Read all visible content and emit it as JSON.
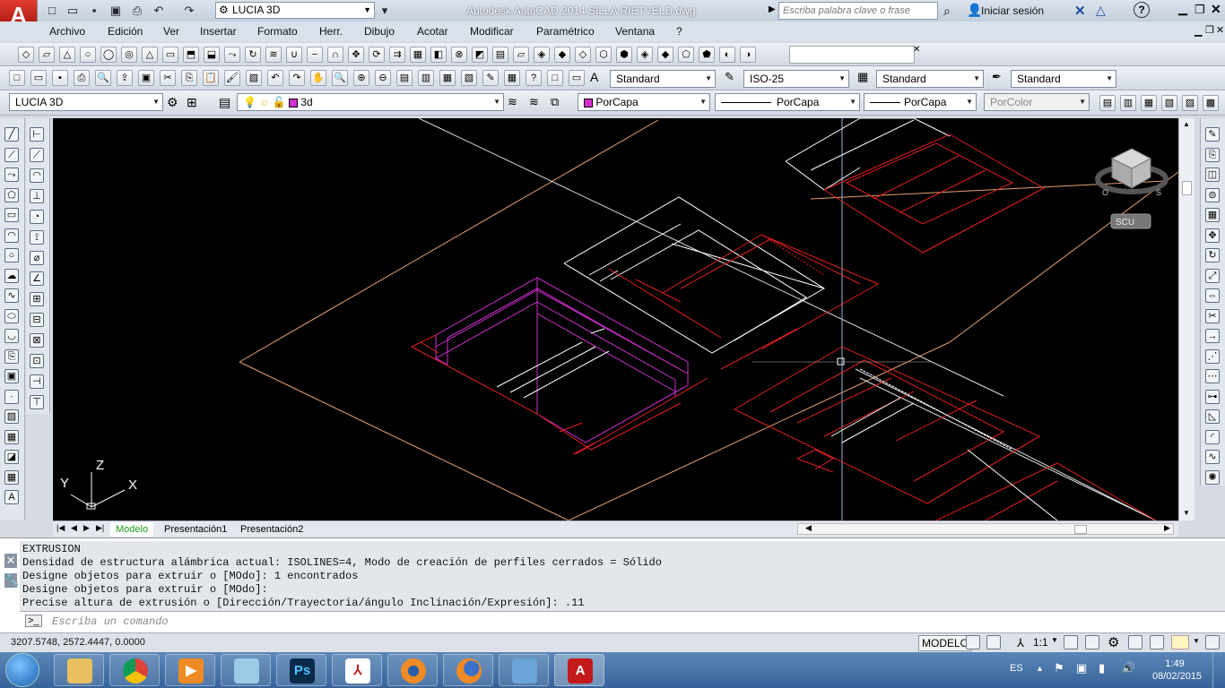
{
  "titlebar": {
    "app_letter": "A",
    "workspace": "LUCIA 3D",
    "title": "Autodesk AutoCAD 2014    SILLA RIETVELD.dwg",
    "search_placeholder": "Escriba palabra clave o frase",
    "signin": "Iniciar sesión",
    "help": "?"
  },
  "menu": [
    "Archivo",
    "Edición",
    "Ver",
    "Insertar",
    "Formato",
    "Herr.",
    "Dibujo",
    "Acotar",
    "Modificar",
    "Paramétrico",
    "Ventana",
    "?"
  ],
  "styles": {
    "text_style": "Standard",
    "dim_style": "ISO-25",
    "table_style": "Standard",
    "mleader_style": "Standard"
  },
  "layers": {
    "workspace_combo": "LUCIA 3D",
    "current_layer": "3d",
    "color": "PorCapa",
    "linetype": "PorCapa",
    "lineweight": "PorCapa",
    "plotstyle": "PorColor"
  },
  "viewport": {
    "viewcube_label": "SCU",
    "ucs_x": "X",
    "ucs_y": "Y",
    "ucs_z": "Z"
  },
  "layout_tabs": [
    "Modelo",
    "Presentación1",
    "Presentación2"
  ],
  "command_history": [
    "EXTRUSION",
    "Densidad de estructura alámbrica actual: ISOLINES=4, Modo de creación de perfiles cerrados = Sólido",
    "Designe objetos para extruir o [MOdo]: 1 encontrados",
    "Designe objetos para extruir o [MOdo]:",
    "Precise altura de extrusión o [Dirección/Trayectoria/ángulo Inclinación/Expresión]: .11"
  ],
  "command_placeholder": "Escriba un comando",
  "status": {
    "coords": "3207.5748, 2572.4447, 0.0000",
    "space": "MODELO",
    "scale": "1:1"
  },
  "taskbar": {
    "lang": "ES",
    "time": "1:49",
    "date": "08/02/2015"
  },
  "colors": {
    "viewport_bg": "#000000",
    "white_lines": "#ffffff",
    "red_lines": "#e02020",
    "magenta_lines": "#d030d0",
    "orange_lines": "#e8a070"
  }
}
